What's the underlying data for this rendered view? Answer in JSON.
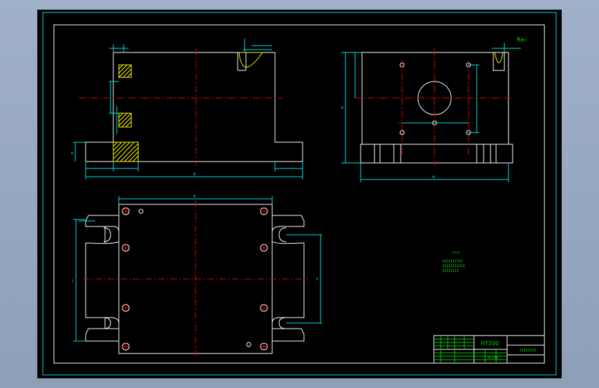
{
  "drawing": {
    "roughness_mark": "Ra√",
    "title_block": {
      "part_name": "HT200",
      "drawing_number": "IIIIIIII",
      "material_row": "HT200"
    },
    "notes": {
      "heading": "????",
      "line1": "IIIIIIIIII",
      "line2": "IIIIIIIIIII",
      "line3": "IIIIIIII"
    },
    "dimensions": {
      "front_height": "H",
      "front_width": "W",
      "side_height": "H",
      "side_width": "W",
      "plan_width": "W",
      "plan_depth": "L",
      "plan_slot_pitch": "P"
    }
  }
}
